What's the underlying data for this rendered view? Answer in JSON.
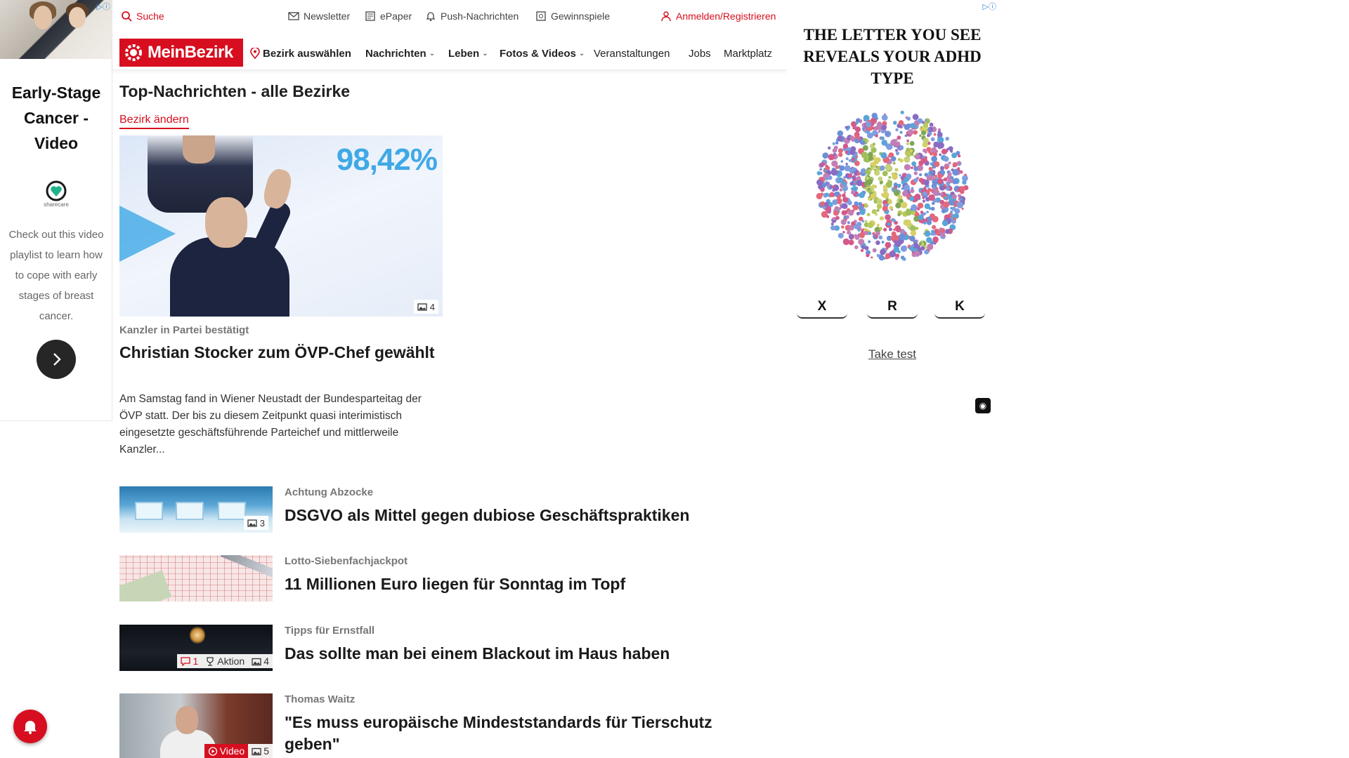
{
  "left_ad": {
    "headline": "Early-Stage Cancer - Video",
    "logo_name": "sharecare",
    "body": "Check out this video playlist to learn how to cope with early stages of breast cancer.",
    "adchoices_icon": "adchoices-icon"
  },
  "utility": {
    "search": "Suche",
    "newsletter": "Newsletter",
    "epaper": "ePaper",
    "push": "Push-Nachrichten",
    "contests": "Gewinnspiele",
    "login": "Anmelden/Registrieren"
  },
  "nav": {
    "brand": "MeinBezirk",
    "district": "Bezirk auswählen",
    "items": [
      {
        "label": "Nachrichten",
        "dropdown": true
      },
      {
        "label": "Leben",
        "dropdown": true
      },
      {
        "label": "Fotos & Videos",
        "dropdown": true
      },
      {
        "label": "Veranstaltungen"
      },
      {
        "label": "Jobs"
      },
      {
        "label": "Marktplatz"
      }
    ]
  },
  "main": {
    "title": "Top-Nachrichten - alle Bezirke",
    "change_district": "Bezirk ändern",
    "hero": {
      "image_text": "98,42%",
      "image_count": "4",
      "kicker": "Kanzler in Partei bestätigt",
      "title": "Christian Stocker zum ÖVP-Chef gewählt",
      "teaser": "Am Samstag fand in Wiener Neustadt der Bundesparteitag der ÖVP statt. Der bis zu diesem Zeitpunkt quasi interimistisch eingesetzte geschäftsführende Parteichef und mittlerweile Kanzler..."
    },
    "articles": [
      {
        "kicker": "Achtung Abzocke",
        "title": "DSGVO als Mittel gegen dubiose Geschäftspraktiken",
        "images": "3"
      },
      {
        "kicker": "Lotto-Siebenfachjackpot",
        "title": "11 Millionen Euro liegen für Sonntag im Topf"
      },
      {
        "kicker": "Tipps für Ernstfall",
        "title": "Das sollte man bei einem Blackout im Haus haben",
        "comments": "1",
        "action": "Aktion",
        "images": "4"
      },
      {
        "kicker": "Thomas Waitz",
        "title": "\"Es muss europäische Mindeststandards für Tierschutz geben\"",
        "video": "Video",
        "images": "5"
      }
    ]
  },
  "right_ad": {
    "headline": "THE LETTER YOU SEE REVEALS YOUR ADHD TYPE",
    "options": [
      "X",
      "R",
      "K"
    ],
    "cta": "Take test"
  },
  "colors": {
    "brand_red": "#d60e1f",
    "accent_blue": "#3fa9e6"
  }
}
